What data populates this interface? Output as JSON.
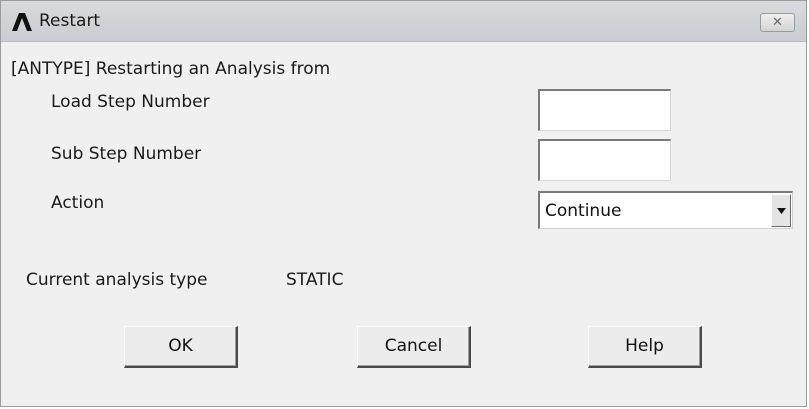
{
  "window": {
    "title": "Restart",
    "close_glyph": "✕",
    "logo_icon": "ansys-logo-icon"
  },
  "form": {
    "heading": "[ANTYPE]  Restarting an Analysis from",
    "load_step_label": "Load Step Number",
    "load_step_value": "",
    "sub_step_label": "Sub Step Number",
    "sub_step_value": "",
    "action_label": "Action",
    "action_value": "Continue",
    "analysis_type_label": "Current analysis type",
    "analysis_type_value": "STATIC"
  },
  "buttons": {
    "ok": "OK",
    "cancel": "Cancel",
    "help": "Help"
  }
}
